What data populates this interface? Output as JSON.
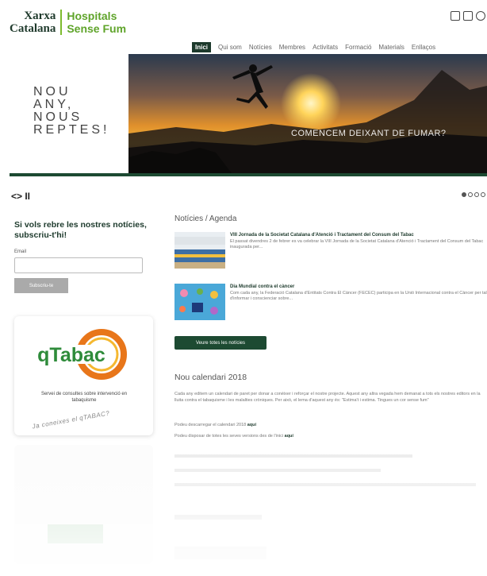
{
  "header": {
    "logo_left_line1": "Xarxa",
    "logo_left_line2": "Catalana",
    "logo_right_line1": "Hospitals",
    "logo_right_line2": "Sense Fum"
  },
  "nav": {
    "items": [
      "Inici",
      "Qui som",
      "Notícies",
      "Membres",
      "Activitats",
      "Formació",
      "Materials",
      "Enllaços"
    ]
  },
  "hero": {
    "text_line1": "NOU",
    "text_line2": "ANY,",
    "text_line3": "NOUS",
    "text_line4": "REPTES!",
    "caption": "COMENCEM DEIXANT DE FUMAR?"
  },
  "slider": {
    "controls": "<> II"
  },
  "subscribe": {
    "title": "Si vols rebre les nostres notícies, subscriu-t'hi!",
    "email_label": "Email",
    "email_value": "",
    "button_label": "Subscriu-te"
  },
  "qtabac": {
    "logo_text": "qTabac",
    "description": "Servei de consultes sobre intervenció en tabaquisme",
    "handwriting": "Ja coneixes el qTABAC?"
  },
  "news": {
    "section_title": "Notícies / Agenda",
    "items": [
      {
        "title": "VIII Jornada de la Societat Catalana d'Atenció i Tractament del Consum del Tabac",
        "excerpt": "El passat divendres 2 de febrer es va celebrar la VIII Jornada de la Societat Catalana d'Atenció i Tractament del Consum del Tabac inaugurada per..."
      },
      {
        "title": "Dia Mundial contra el càncer",
        "excerpt": "Com cada any, la Federació Catalana d'Entitats Contra El Càncer (FECEC) participa en la Unió Internacional contra el Càncer per tal d'informar i conscienciar sobre..."
      }
    ],
    "all_button": "Veure totes les notícies"
  },
  "calendar": {
    "title": "Nou calendari 2018",
    "para1": "Cada any editem un calendari de paret per donar a conèixer i reforçar el nostre projecte. Aquest any altra vegada hem demanat a tots els nostres editors en la lluita contra el tabaquisme i les malalties cròniques. Per això, el lema d'aquest any és: \"Estima't i estima. Tingues un cor sense fum\"",
    "para2_text": "Podeu descarregar el calendari 2018 ",
    "para2_link": "aquí",
    "para3_text": "Podeu disposar de totes les seves versions des de l'inici ",
    "para3_link": "aquí"
  },
  "colors": {
    "brand_dark": "#1d4a32",
    "brand_green": "#5fa42a",
    "qtabac_orange": "#e8761a",
    "qtabac_green": "#2e8b3a"
  }
}
